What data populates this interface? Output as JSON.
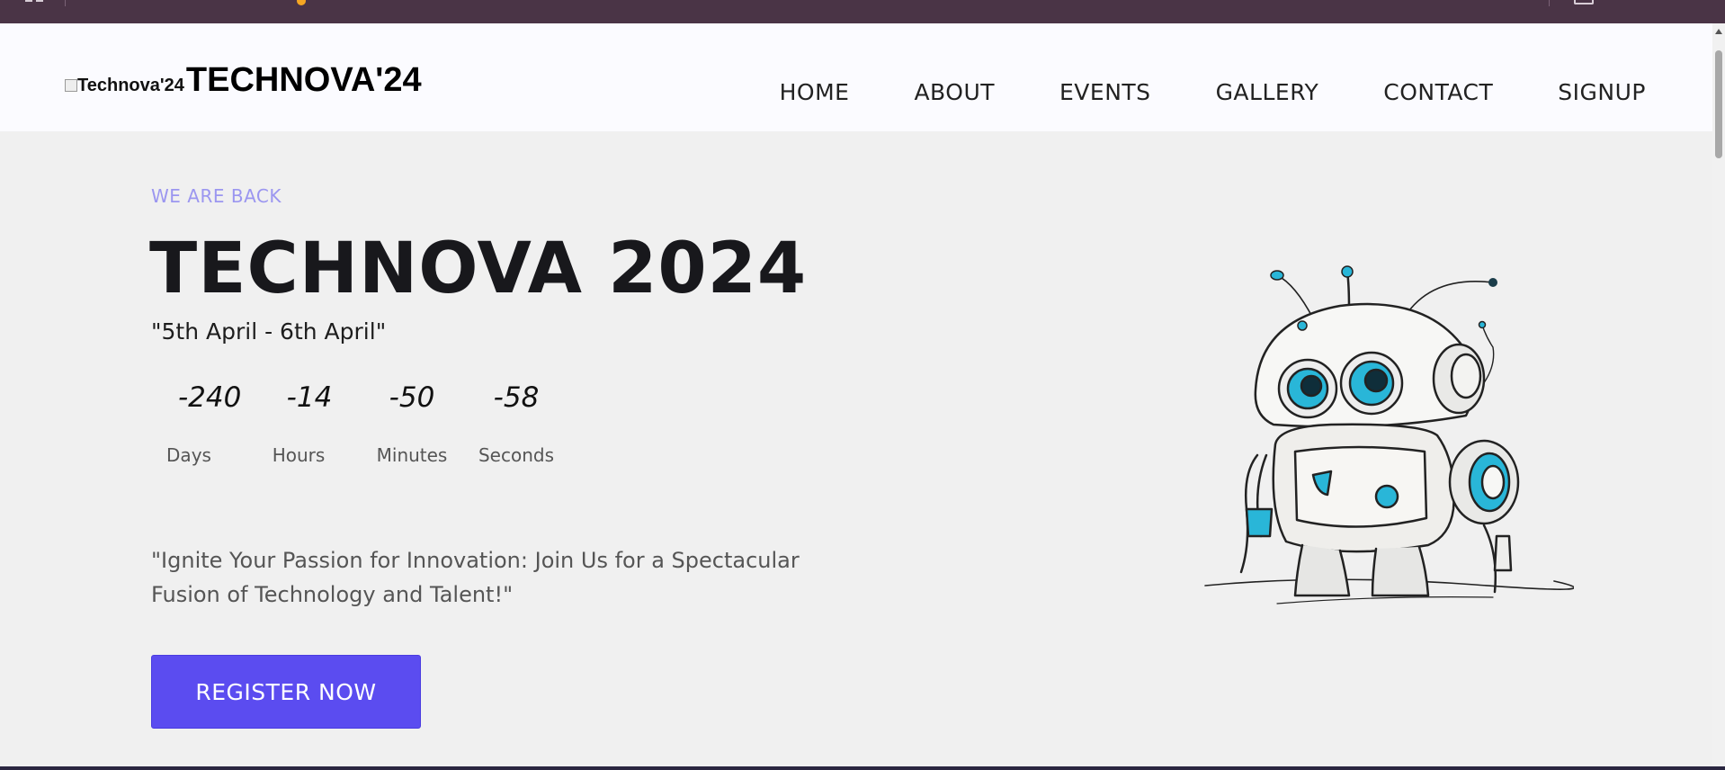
{
  "brand": {
    "logo_alt": "Technova'24",
    "name": "TECHNOVA'24"
  },
  "nav": {
    "items": [
      "HOME",
      "ABOUT",
      "EVENTS",
      "GALLERY",
      "CONTACT",
      "SIGNUP"
    ]
  },
  "hero": {
    "eyebrow": "WE ARE BACK",
    "title": "TECHNOVA 2024",
    "dates": "\"5th April - 6th April\"",
    "countdown": [
      {
        "value": "-240",
        "label": "Days"
      },
      {
        "value": "-14",
        "label": "Hours"
      },
      {
        "value": "-50",
        "label": "Minutes"
      },
      {
        "value": "-58",
        "label": "Seconds"
      }
    ],
    "tagline": "\"Ignite Your Passion for Innovation: Join Us for a Spectacular Fusion of Technology and Talent!\"",
    "cta_label": "REGISTER NOW"
  },
  "colors": {
    "topbar": "#4a3446",
    "accent": "#5b4cf0",
    "eyebrow": "#9b96f0",
    "robot_blue": "#29b6d8"
  }
}
